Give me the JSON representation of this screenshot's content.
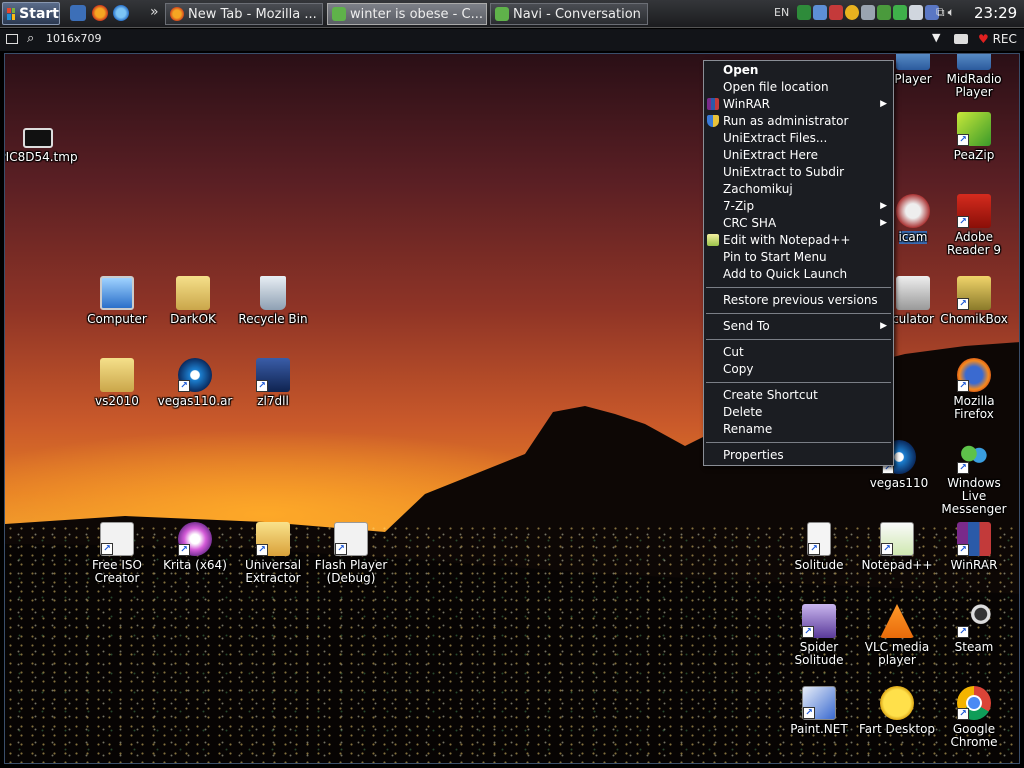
{
  "taskbar": {
    "start_label": "Start",
    "tasks": [
      {
        "label": "New Tab - Mozilla ..."
      },
      {
        "label": "winter is obese - C..."
      },
      {
        "label": "Navi - Conversation"
      }
    ],
    "language": "EN",
    "clock": "23:29",
    "colors": {
      "start_bg": "#3b4a66",
      "task_active": "#6c6f76"
    }
  },
  "viewer": {
    "size_text": "1016x709",
    "rec_label": "REC"
  },
  "desktop": {
    "icons": [
      {
        "label": "PIC8D54.tmp",
        "icon": "tmp-file-icon"
      },
      {
        "label": "Computer",
        "icon": "computer-icon"
      },
      {
        "label": "DarkOK",
        "icon": "folder-icon"
      },
      {
        "label": "Recycle Bin",
        "icon": "recycle-bin-icon"
      },
      {
        "label": "vs2010",
        "icon": "folder-icon"
      },
      {
        "label": "vegas110.ar",
        "icon": "vegas-icon"
      },
      {
        "label": "zl7dll",
        "icon": "flash-icon"
      },
      {
        "label": "Free ISO\nCreator",
        "icon": "iso-icon"
      },
      {
        "label": "Krita (x64)",
        "icon": "krita-icon"
      },
      {
        "label": "Universal\nExtractor",
        "icon": "extractor-icon"
      },
      {
        "label": "Flash Player\n(Debug)",
        "icon": "flash-debug-icon"
      },
      {
        "label": "Player",
        "icon": "player-icon"
      },
      {
        "label": "MidRadio\nPlayer",
        "icon": "midradio-icon"
      },
      {
        "label": "PeaZip",
        "icon": "peazip-icon"
      },
      {
        "label": "icam",
        "icon": "icam-icon"
      },
      {
        "label": "Adobe\nReader 9",
        "icon": "adobe-reader-icon"
      },
      {
        "label": "culator",
        "icon": "calculator-icon"
      },
      {
        "label": "ChomikBox",
        "icon": "chomikbox-icon"
      },
      {
        "label": "Mozilla\nFirefox",
        "icon": "firefox-icon"
      },
      {
        "label": "vegas110",
        "icon": "vegas-icon"
      },
      {
        "label": "Windows Live\nMessenger",
        "icon": "messenger-icon"
      },
      {
        "label": "Solitude",
        "icon": "solitude-icon"
      },
      {
        "label": "Notepad++",
        "icon": "notepadpp-icon"
      },
      {
        "label": "WinRAR",
        "icon": "winrar-icon"
      },
      {
        "label": "Spider\nSolitude",
        "icon": "spider-icon"
      },
      {
        "label": "VLC media\nplayer",
        "icon": "vlc-icon"
      },
      {
        "label": "Steam",
        "icon": "steam-icon"
      },
      {
        "label": "Paint.NET",
        "icon": "paintnet-icon"
      },
      {
        "label": "Fart Desktop",
        "icon": "fart-icon"
      },
      {
        "label": "Google\nChrome",
        "icon": "chrome-icon"
      }
    ]
  },
  "context_menu": {
    "items": [
      {
        "label": "Open"
      },
      {
        "label": "Open file location"
      },
      {
        "label": "WinRAR"
      },
      {
        "label": "Run as administrator"
      },
      {
        "label": "UniExtract Files..."
      },
      {
        "label": "UniExtract Here"
      },
      {
        "label": "UniExtract to Subdir"
      },
      {
        "label": "Zachomikuj"
      },
      {
        "label": "7-Zip"
      },
      {
        "label": "CRC SHA"
      },
      {
        "label": "Edit with Notepad++"
      },
      {
        "label": "Pin to Start Menu"
      },
      {
        "label": "Add to Quick Launch"
      },
      {
        "label": "Restore previous versions"
      },
      {
        "label": "Send To"
      },
      {
        "label": "Cut"
      },
      {
        "label": "Copy"
      },
      {
        "label": "Create Shortcut"
      },
      {
        "label": "Delete"
      },
      {
        "label": "Rename"
      },
      {
        "label": "Properties"
      }
    ]
  }
}
